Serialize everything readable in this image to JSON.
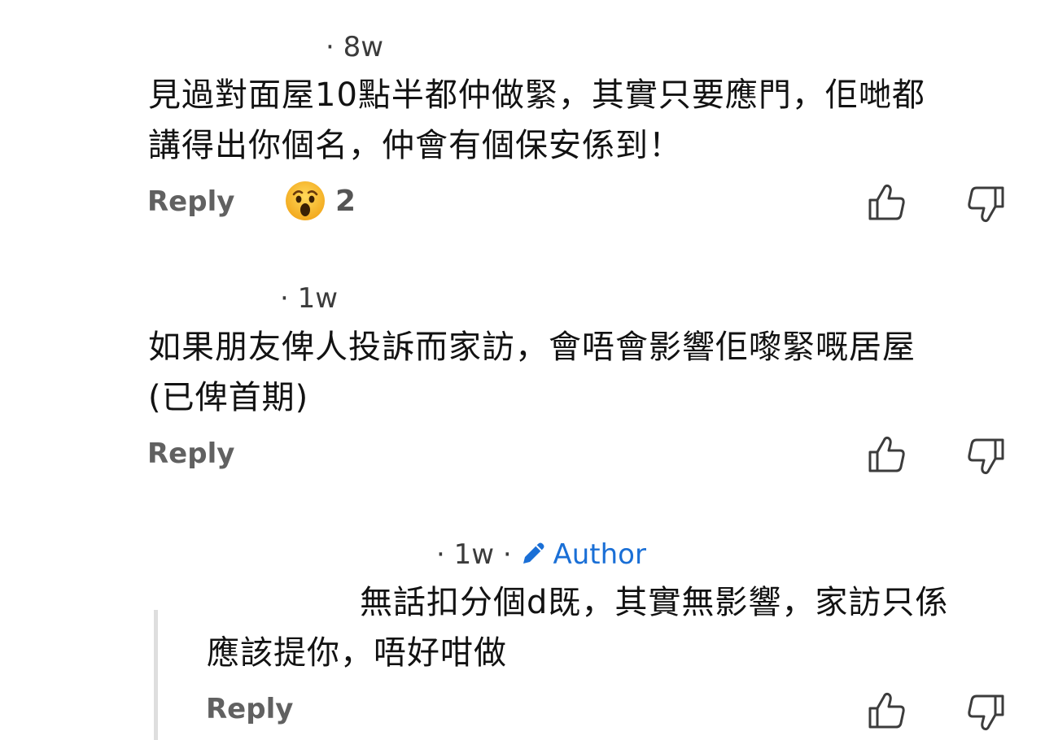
{
  "comments": [
    {
      "time": "· 8w",
      "lines": [
        "見過對面屋10點半都仲做緊，其實只要應門，佢哋都",
        "講得出你個名，仲會有個保安係到！"
      ],
      "reply_label": "Reply",
      "reaction": {
        "emoji": "wow-emoji",
        "count": "2"
      }
    },
    {
      "time": "· 1w",
      "lines": [
        "如果朋友俾人投訴而家訪，會唔會影響佢嚟緊嘅居屋",
        "(已俾首期)"
      ],
      "reply_label": "Reply"
    },
    {
      "time": "· 1w ·",
      "author_label": "Author",
      "lines": [
        "無話扣分個d既，其實無影響，家訪只係",
        "應該提你，唔好咁做"
      ],
      "reply_label": "Reply"
    }
  ],
  "icons": {
    "upvote": "thumbs-up-icon",
    "downvote": "thumbs-down-icon",
    "author": "pencil-icon"
  },
  "colors": {
    "author_blue": "#1a6fd6",
    "reply_gray": "#616161",
    "thread_line": "#dedede",
    "emoji_yellow": "#f7b125"
  }
}
